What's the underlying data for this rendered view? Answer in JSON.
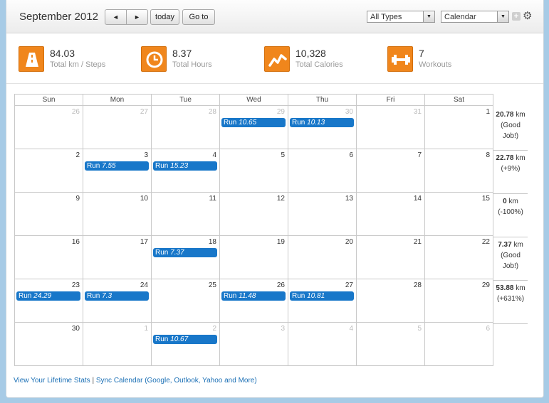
{
  "header": {
    "title": "September 2012",
    "prev_label": "◄",
    "next_label": "►",
    "today_label": "today",
    "goto_label": "Go to",
    "type_filter": "All Types",
    "view_select": "Calendar"
  },
  "stats": [
    {
      "value": "84.03",
      "label": "Total km / Steps",
      "icon": "road-icon"
    },
    {
      "value": "8.37",
      "label": "Total Hours",
      "icon": "clock-icon"
    },
    {
      "value": "10,328",
      "label": "Total Calories",
      "icon": "trend-icon"
    },
    {
      "value": "7",
      "label": "Workouts",
      "icon": "dumbbell-icon"
    }
  ],
  "weekdays": [
    "Sun",
    "Mon",
    "Tue",
    "Wed",
    "Thu",
    "Fri",
    "Sat"
  ],
  "weeks": [
    {
      "days": [
        {
          "n": "26",
          "other": true
        },
        {
          "n": "27",
          "other": true
        },
        {
          "n": "28",
          "other": true
        },
        {
          "n": "29",
          "other": true,
          "event": {
            "type": "Run",
            "value": "10.65"
          }
        },
        {
          "n": "30",
          "other": true,
          "event": {
            "type": "Run",
            "value": "10.13"
          }
        },
        {
          "n": "31",
          "other": true
        },
        {
          "n": "1"
        }
      ],
      "summary": {
        "km": "20.78",
        "unit": "km",
        "note": "(Good Job!)"
      }
    },
    {
      "days": [
        {
          "n": "2"
        },
        {
          "n": "3",
          "event": {
            "type": "Run",
            "value": "7.55"
          }
        },
        {
          "n": "4",
          "event": {
            "type": "Run",
            "value": "15.23"
          }
        },
        {
          "n": "5"
        },
        {
          "n": "6"
        },
        {
          "n": "7"
        },
        {
          "n": "8"
        }
      ],
      "summary": {
        "km": "22.78",
        "unit": "km",
        "note": "(+9%)"
      }
    },
    {
      "days": [
        {
          "n": "9"
        },
        {
          "n": "10"
        },
        {
          "n": "11"
        },
        {
          "n": "12"
        },
        {
          "n": "13"
        },
        {
          "n": "14"
        },
        {
          "n": "15"
        }
      ],
      "summary": {
        "km": "0",
        "unit": "km",
        "note": "(-100%)"
      }
    },
    {
      "days": [
        {
          "n": "16"
        },
        {
          "n": "17"
        },
        {
          "n": "18",
          "event": {
            "type": "Run",
            "value": "7.37"
          }
        },
        {
          "n": "19"
        },
        {
          "n": "20"
        },
        {
          "n": "21"
        },
        {
          "n": "22"
        }
      ],
      "summary": {
        "km": "7.37",
        "unit": "km",
        "note": "(Good Job!)"
      }
    },
    {
      "days": [
        {
          "n": "23",
          "event": {
            "type": "Run",
            "value": "24.29"
          }
        },
        {
          "n": "24",
          "event": {
            "type": "Run",
            "value": "7.3"
          }
        },
        {
          "n": "25"
        },
        {
          "n": "26",
          "event": {
            "type": "Run",
            "value": "11.48"
          }
        },
        {
          "n": "27",
          "event": {
            "type": "Run",
            "value": "10.81"
          }
        },
        {
          "n": "28"
        },
        {
          "n": "29"
        }
      ],
      "summary": {
        "km": "53.88",
        "unit": "km",
        "note": "(+631%)"
      }
    },
    {
      "days": [
        {
          "n": "30"
        },
        {
          "n": "1",
          "other": true
        },
        {
          "n": "2",
          "other": true,
          "event": {
            "type": "Run",
            "value": "10.67"
          }
        },
        {
          "n": "3",
          "other": true
        },
        {
          "n": "4",
          "other": true
        },
        {
          "n": "5",
          "other": true
        },
        {
          "n": "6",
          "other": true
        }
      ]
    }
  ],
  "footer": {
    "lifetime_link": "View Your Lifetime Stats",
    "separator": "|",
    "sync_link": "Sync Calendar (Google, Outlook, Yahoo and More)"
  }
}
